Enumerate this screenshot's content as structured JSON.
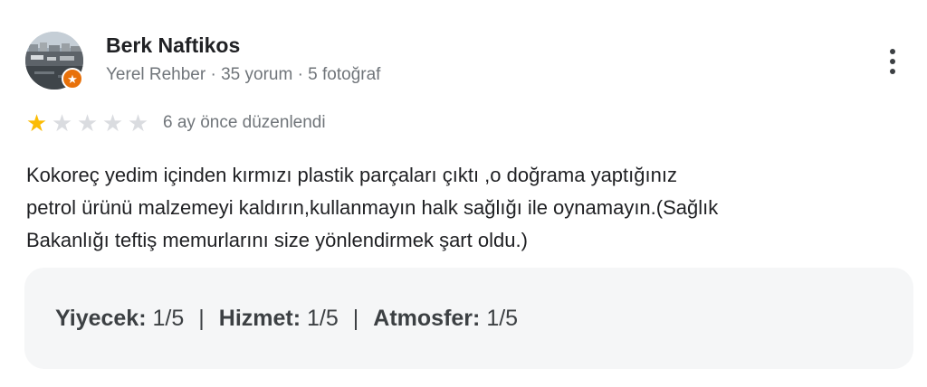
{
  "reviewer": {
    "name": "Berk Naftikos",
    "meta": "Yerel Rehber · 35 yorum · 5 fotoğraf",
    "badge_icon": "local-guide-star-icon"
  },
  "rating": {
    "value": 1,
    "max": 5,
    "time": "6 ay önce düzenlendi"
  },
  "review": {
    "lines": [
      "Kokoreç yedim içinden kırmızı plastik parçaları çıktı ,o doğrama yaptığınız",
      "petrol ürünü malzemeyi kaldırın,kullanmayın halk sağlığı ile oynamayın.(Sağlık",
      "Bakanlığı teftiş memurlarını size yönlendirmek şart oldu.)"
    ]
  },
  "attributes": [
    {
      "label": "Yiyecek:",
      "value": "1/5"
    },
    {
      "label": "Hizmet:",
      "value": "1/5"
    },
    {
      "label": "Atmosfer:",
      "value": "1/5"
    }
  ],
  "separator": "|",
  "colors": {
    "star_on": "#fbbc04",
    "star_off": "#dadce0",
    "badge": "#e8710a"
  }
}
